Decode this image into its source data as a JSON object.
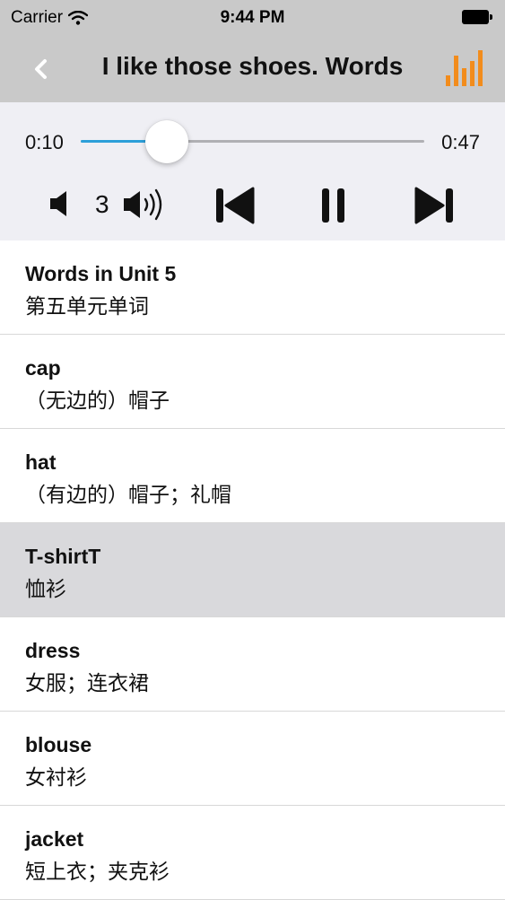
{
  "status_bar": {
    "carrier": "Carrier",
    "time": "9:44 PM"
  },
  "nav": {
    "title": "I like those shoes. Words"
  },
  "player": {
    "current_time": "0:10",
    "total_time": "0:47",
    "progress": 0.25,
    "volume": "3",
    "accent_color": "#2d9fd9"
  },
  "words": [
    {
      "en": "Words in Unit 5",
      "zh": "第五单元单词"
    },
    {
      "en": "cap",
      "zh": "（无边的）帽子"
    },
    {
      "en": "hat",
      "zh": "（有边的）帽子；礼帽"
    },
    {
      "en": "T-shirtT",
      "zh": "恤衫"
    },
    {
      "en": "dress",
      "zh": "女服；连衣裙"
    },
    {
      "en": "blouse",
      "zh": "女衬衫"
    },
    {
      "en": "jacket",
      "zh": "短上衣；夹克衫"
    }
  ],
  "selected_index": 3,
  "icons": {
    "back": "chevron-left-icon",
    "bars": "bar-chart-icon",
    "volume_low": "speaker-low-icon",
    "volume_high": "speaker-high-icon",
    "previous": "skip-previous-icon",
    "pause": "pause-icon",
    "next": "skip-next-icon",
    "bars_color": "#f28c1c"
  }
}
